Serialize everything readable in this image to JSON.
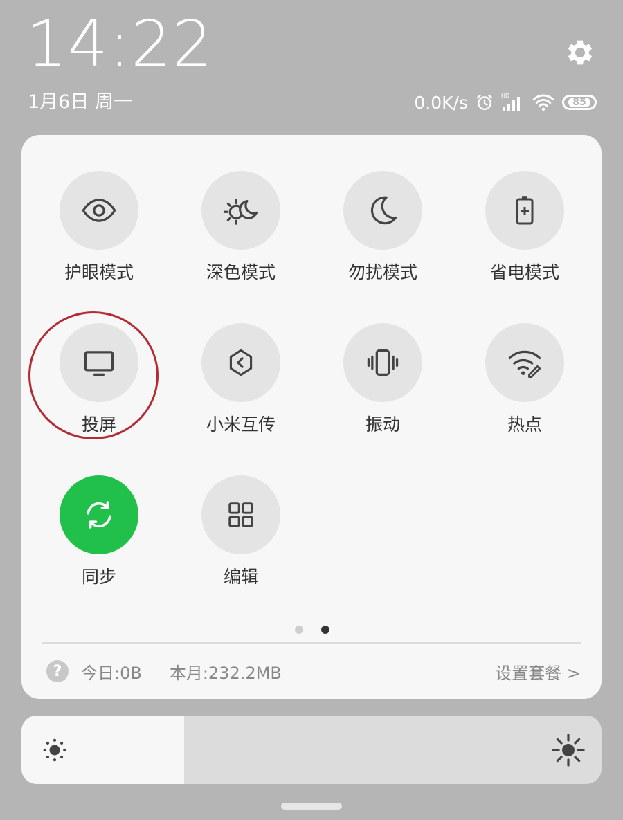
{
  "status": {
    "time": "14:22",
    "date": "1月6日 周一",
    "net_speed": "0.0K/s",
    "battery": "85"
  },
  "tiles": [
    {
      "label": "护眼模式",
      "icon": "eye-icon",
      "active": false
    },
    {
      "label": "深色模式",
      "icon": "dark-mode-icon",
      "active": false
    },
    {
      "label": "勿扰模式",
      "icon": "moon-icon",
      "active": false
    },
    {
      "label": "省电模式",
      "icon": "battery-saver-icon",
      "active": false
    },
    {
      "label": "投屏",
      "icon": "screen-cast-icon",
      "active": false
    },
    {
      "label": "小米互传",
      "icon": "mi-share-icon",
      "active": false
    },
    {
      "label": "振动",
      "icon": "vibrate-icon",
      "active": false
    },
    {
      "label": "热点",
      "icon": "hotspot-icon",
      "active": false
    },
    {
      "label": "同步",
      "icon": "sync-icon",
      "active": true
    },
    {
      "label": "编辑",
      "icon": "grid-icon",
      "active": false
    }
  ],
  "pager": {
    "count": 2,
    "current": 2
  },
  "data_usage": {
    "help_icon": "?",
    "today": "今日:0B",
    "month": "本月:232.2MB",
    "plan_link": "设置套餐 >"
  },
  "brightness": {
    "level": 0.28
  },
  "colors": {
    "active_tile": "#21c04a",
    "highlight_ring": "#b22c33"
  }
}
